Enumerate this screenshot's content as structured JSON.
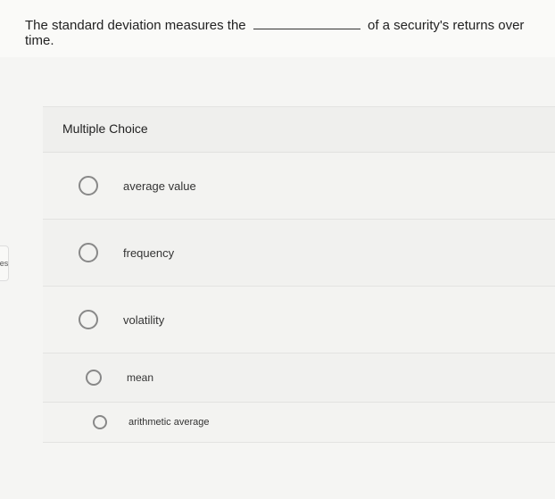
{
  "question": {
    "part1": "The standard deviation measures the",
    "part2": "of a security's returns over time."
  },
  "heading": "Multiple Choice",
  "options": [
    {
      "label": "average value"
    },
    {
      "label": "frequency"
    },
    {
      "label": "volatility"
    },
    {
      "label": "mean"
    },
    {
      "label": "arithmetic average"
    }
  ],
  "sideStub": "es"
}
